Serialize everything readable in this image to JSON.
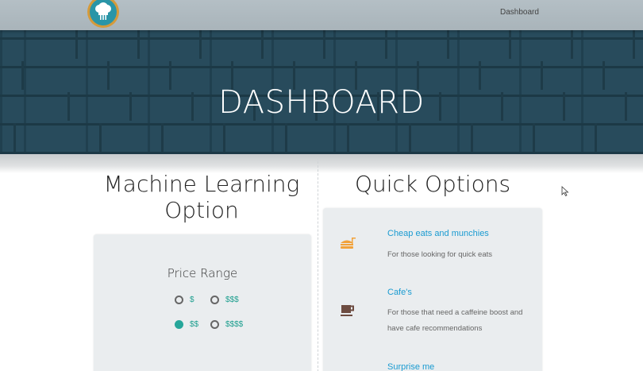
{
  "nav": {
    "logo_icon": "chef-hat-icon",
    "links": [
      "Dashboard"
    ]
  },
  "hero": {
    "title": "DASHBOARD"
  },
  "ml_section": {
    "title": "Machine Learning Option",
    "price_range": {
      "label": "Price Range",
      "options": [
        {
          "label": "$",
          "checked": false
        },
        {
          "label": "$$$",
          "checked": false
        },
        {
          "label": "$$",
          "checked": true
        },
        {
          "label": "$$$$",
          "checked": false
        }
      ]
    }
  },
  "quick_options": {
    "title": "Quick Options",
    "items": [
      {
        "icon": "fast-food-icon",
        "title": "Cheap eats and munchies",
        "description": "For those looking for quick eats"
      },
      {
        "icon": "coffee-cup-icon",
        "title": "Cafe's",
        "description": "For those that need a caffeine boost and have cafe recommendations"
      },
      {
        "icon": "surprise-icon",
        "title": "Surprise me",
        "description": ""
      }
    ]
  },
  "colors": {
    "nav_bg": "#b0bbc1",
    "accent_teal": "#26a69a",
    "link_blue": "#1a9bd1",
    "card_bg": "#eaedef",
    "icon_orange": "#f2a23a",
    "icon_brown": "#6d4c41"
  }
}
